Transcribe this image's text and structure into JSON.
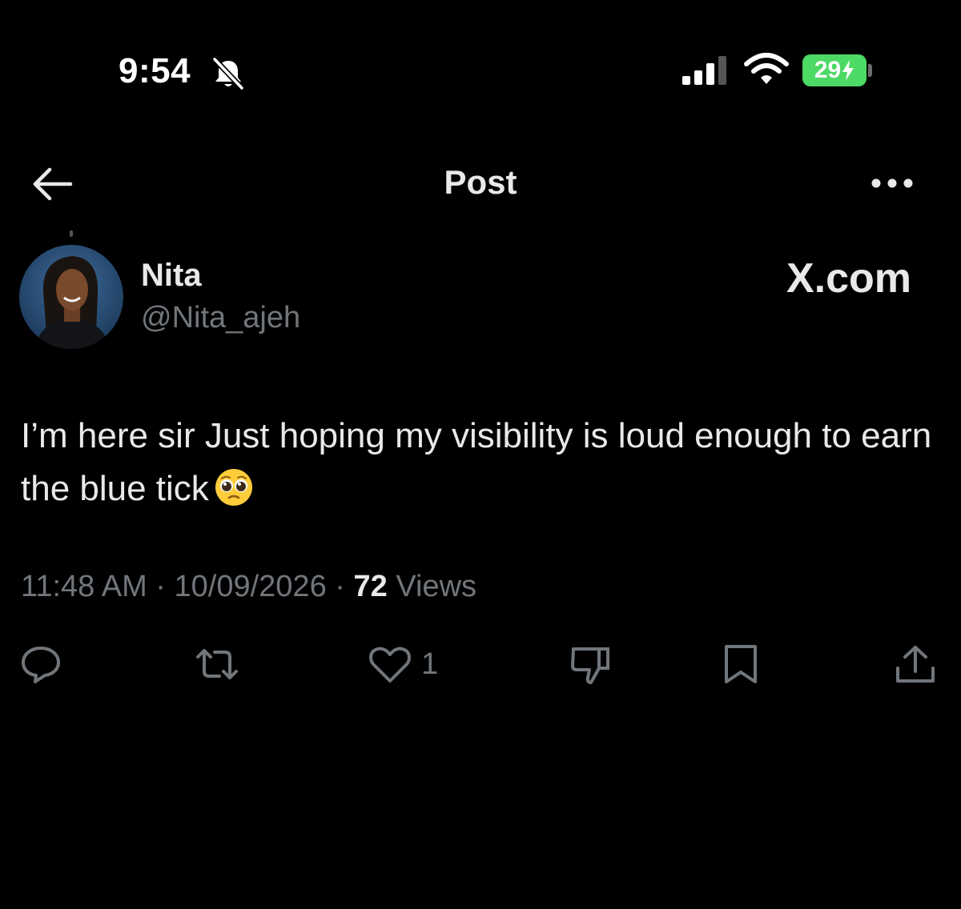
{
  "status_bar": {
    "time": "9:54",
    "battery": "29",
    "icons": [
      "bell-slash-icon",
      "cellular-signal-icon",
      "wifi-icon",
      "battery-charging-icon"
    ]
  },
  "header": {
    "title": "Post",
    "back_icon": "arrow-left-icon",
    "more_icon": "ellipsis-icon"
  },
  "author": {
    "name": "Nita",
    "handle": "@Nita_ajeh"
  },
  "watermark": "X.com",
  "post": {
    "text": "I’m here sir Just hoping my visibility is loud enough to earn the blue tick",
    "emoji": "pleading-face-emoji"
  },
  "meta": {
    "time": "11:48 AM",
    "separator": "·",
    "date": "10/09/2026",
    "views_count": "72",
    "views_label": "Views"
  },
  "actions": {
    "reply_icon": "reply-icon",
    "repost_icon": "repost-icon",
    "like_icon": "heart-icon",
    "like_count": "1",
    "dislike_icon": "thumbs-down-icon",
    "bookmark_icon": "bookmark-icon",
    "share_icon": "share-icon"
  },
  "colors": {
    "background": "#000000",
    "text_primary": "#e7e9ea",
    "text_secondary": "#71767b",
    "battery": "#4cd964"
  }
}
